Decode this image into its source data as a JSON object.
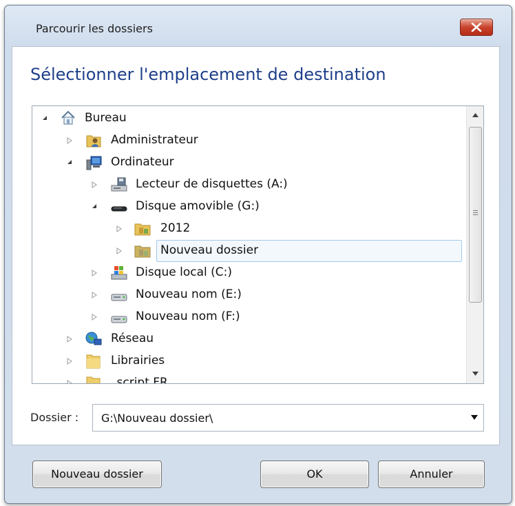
{
  "window": {
    "title": "Parcourir les dossiers",
    "close_icon": "close-icon"
  },
  "instruction": "Sélectionner l'emplacement de destination",
  "tree": {
    "items": [
      {
        "label": "Bureau",
        "icon": "desktop-home-icon",
        "expander": "expanded"
      },
      {
        "label": "Administrateur",
        "icon": "user-folder-icon",
        "expander": "collapsed"
      },
      {
        "label": "Ordinateur",
        "icon": "computer-icon",
        "expander": "expanded"
      },
      {
        "label": "Lecteur de disquettes (A:)",
        "icon": "floppy-drive-icon",
        "expander": "collapsed"
      },
      {
        "label": "Disque amovible (G:)",
        "icon": "removable-drive-icon",
        "expander": "expanded"
      },
      {
        "label": "2012",
        "icon": "folder-icon",
        "expander": "collapsed"
      },
      {
        "label": "Nouveau dossier",
        "icon": "folder-icon",
        "expander": "collapsed",
        "selected": true
      },
      {
        "label": "Disque local (C:)",
        "icon": "system-drive-icon",
        "expander": "collapsed"
      },
      {
        "label": "Nouveau nom (E:)",
        "icon": "hard-drive-icon",
        "expander": "collapsed"
      },
      {
        "label": "Nouveau nom (F:)",
        "icon": "hard-drive-icon",
        "expander": "collapsed"
      },
      {
        "label": "Réseau",
        "icon": "network-icon",
        "expander": "collapsed"
      },
      {
        "label": "Librairies",
        "icon": "folder-icon",
        "expander": "collapsed"
      },
      {
        "label": "_script FR",
        "icon": "folder-icon",
        "expander": "collapsed"
      }
    ]
  },
  "folder_field": {
    "label": "Dossier :",
    "value": "G:\\Nouveau dossier\\"
  },
  "buttons": {
    "new_folder": "Nouveau dossier",
    "ok": "OK",
    "cancel": "Annuler"
  },
  "colors": {
    "instruction": "#1e3f8a",
    "close_button": "#c9432d",
    "selection_border": "#a5c9e9"
  }
}
